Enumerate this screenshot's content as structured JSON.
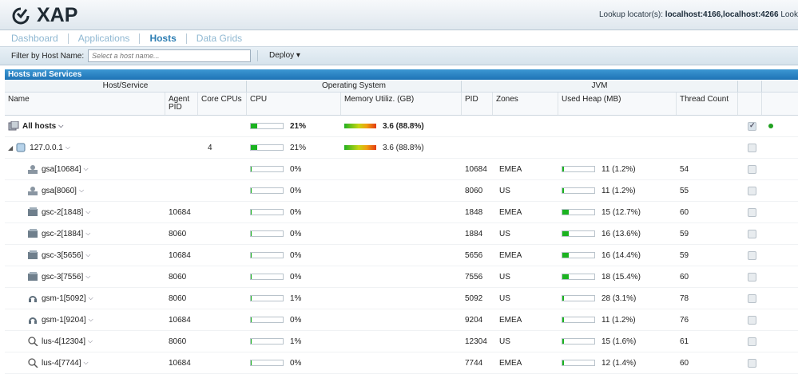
{
  "header": {
    "logo_text": "XAP",
    "lookup_label": "Lookup locator(s):",
    "lookup_value": "localhost:4166,localhost:4266",
    "lookup_trailing": "Look"
  },
  "tabs": [
    {
      "label": "Dashboard"
    },
    {
      "label": "Applications"
    },
    {
      "label": "Hosts"
    },
    {
      "label": "Data Grids"
    }
  ],
  "filter": {
    "label": "Filter by Host Name:",
    "placeholder": "Select a host name...",
    "deploy_label": "Deploy ▾"
  },
  "panel": {
    "title": "Hosts and Services"
  },
  "groups": {
    "host": "Host/Service",
    "os": "Operating System",
    "jvm": "JVM"
  },
  "columns": {
    "name": "Name",
    "agent": "Agent PID",
    "cores": "Core CPUs",
    "cpu": "CPU",
    "mem": "Memory Utiliz. (GB)",
    "pid": "PID",
    "zones": "Zones",
    "heap": "Used Heap (MB)",
    "threads": "Thread Count"
  },
  "rows": [
    {
      "name": "All hosts",
      "icon": "hosts-icon",
      "agent": "",
      "cores": "",
      "cpu": "21%",
      "cpu_frac": 0.21,
      "mem": "3.6 (88.8%)",
      "pid": "",
      "zones": "",
      "heap": "",
      "heap_frac": 0,
      "threads": "",
      "checked": true,
      "status": "ok"
    },
    {
      "name": "127.0.0.1",
      "icon": "host-icon",
      "agent": "",
      "cores": "4",
      "cpu": "21%",
      "cpu_frac": 0.21,
      "mem": "3.6 (88.8%)",
      "pid": "",
      "zones": "",
      "heap": "",
      "heap_frac": 0,
      "threads": "",
      "checked": false
    },
    {
      "name": "gsa[10684]",
      "icon": "agent-icon",
      "agent": "",
      "cores": "",
      "cpu": "0%",
      "cpu_frac": 0.02,
      "mem": "",
      "pid": "10684",
      "zones": "EMEA",
      "heap": "11 (1.2%)",
      "heap_frac": 0.05,
      "threads": "54",
      "checked": false
    },
    {
      "name": "gsa[8060]",
      "icon": "agent-icon",
      "agent": "",
      "cores": "",
      "cpu": "0%",
      "cpu_frac": 0.02,
      "mem": "",
      "pid": "8060",
      "zones": "US",
      "heap": "11 (1.2%)",
      "heap_frac": 0.05,
      "threads": "55",
      "checked": false
    },
    {
      "name": "gsc-2[1848]",
      "icon": "container-icon",
      "agent": "10684",
      "cores": "",
      "cpu": "0%",
      "cpu_frac": 0.02,
      "mem": "",
      "pid": "1848",
      "zones": "EMEA",
      "heap": "15 (12.7%)",
      "heap_frac": 0.2,
      "threads": "60",
      "checked": false
    },
    {
      "name": "gsc-2[1884]",
      "icon": "container-icon",
      "agent": "8060",
      "cores": "",
      "cpu": "0%",
      "cpu_frac": 0.02,
      "mem": "",
      "pid": "1884",
      "zones": "US",
      "heap": "16 (13.6%)",
      "heap_frac": 0.2,
      "threads": "59",
      "checked": false
    },
    {
      "name": "gsc-3[5656]",
      "icon": "container-icon",
      "agent": "10684",
      "cores": "",
      "cpu": "0%",
      "cpu_frac": 0.02,
      "mem": "",
      "pid": "5656",
      "zones": "EMEA",
      "heap": "16 (14.4%)",
      "heap_frac": 0.2,
      "threads": "59",
      "checked": false
    },
    {
      "name": "gsc-3[7556]",
      "icon": "container-icon",
      "agent": "8060",
      "cores": "",
      "cpu": "0%",
      "cpu_frac": 0.02,
      "mem": "",
      "pid": "7556",
      "zones": "US",
      "heap": "18 (15.4%)",
      "heap_frac": 0.2,
      "threads": "60",
      "checked": false
    },
    {
      "name": "gsm-1[5092]",
      "icon": "manager-icon",
      "agent": "8060",
      "cores": "",
      "cpu": "1%",
      "cpu_frac": 0.02,
      "mem": "",
      "pid": "5092",
      "zones": "US",
      "heap": "28 (3.1%)",
      "heap_frac": 0.05,
      "threads": "78",
      "checked": false
    },
    {
      "name": "gsm-1[9204]",
      "icon": "manager-icon",
      "agent": "10684",
      "cores": "",
      "cpu": "0%",
      "cpu_frac": 0.02,
      "mem": "",
      "pid": "9204",
      "zones": "EMEA",
      "heap": "11 (1.2%)",
      "heap_frac": 0.05,
      "threads": "76",
      "checked": false
    },
    {
      "name": "lus-4[12304]",
      "icon": "lookup-icon",
      "agent": "8060",
      "cores": "",
      "cpu": "1%",
      "cpu_frac": 0.02,
      "mem": "",
      "pid": "12304",
      "zones": "US",
      "heap": "15 (1.6%)",
      "heap_frac": 0.05,
      "threads": "61",
      "checked": false
    },
    {
      "name": "lus-4[7744]",
      "icon": "lookup-icon",
      "agent": "10684",
      "cores": "",
      "cpu": "0%",
      "cpu_frac": 0.02,
      "mem": "",
      "pid": "7744",
      "zones": "EMEA",
      "heap": "12 (1.4%)",
      "heap_frac": 0.05,
      "threads": "60",
      "checked": false
    }
  ]
}
